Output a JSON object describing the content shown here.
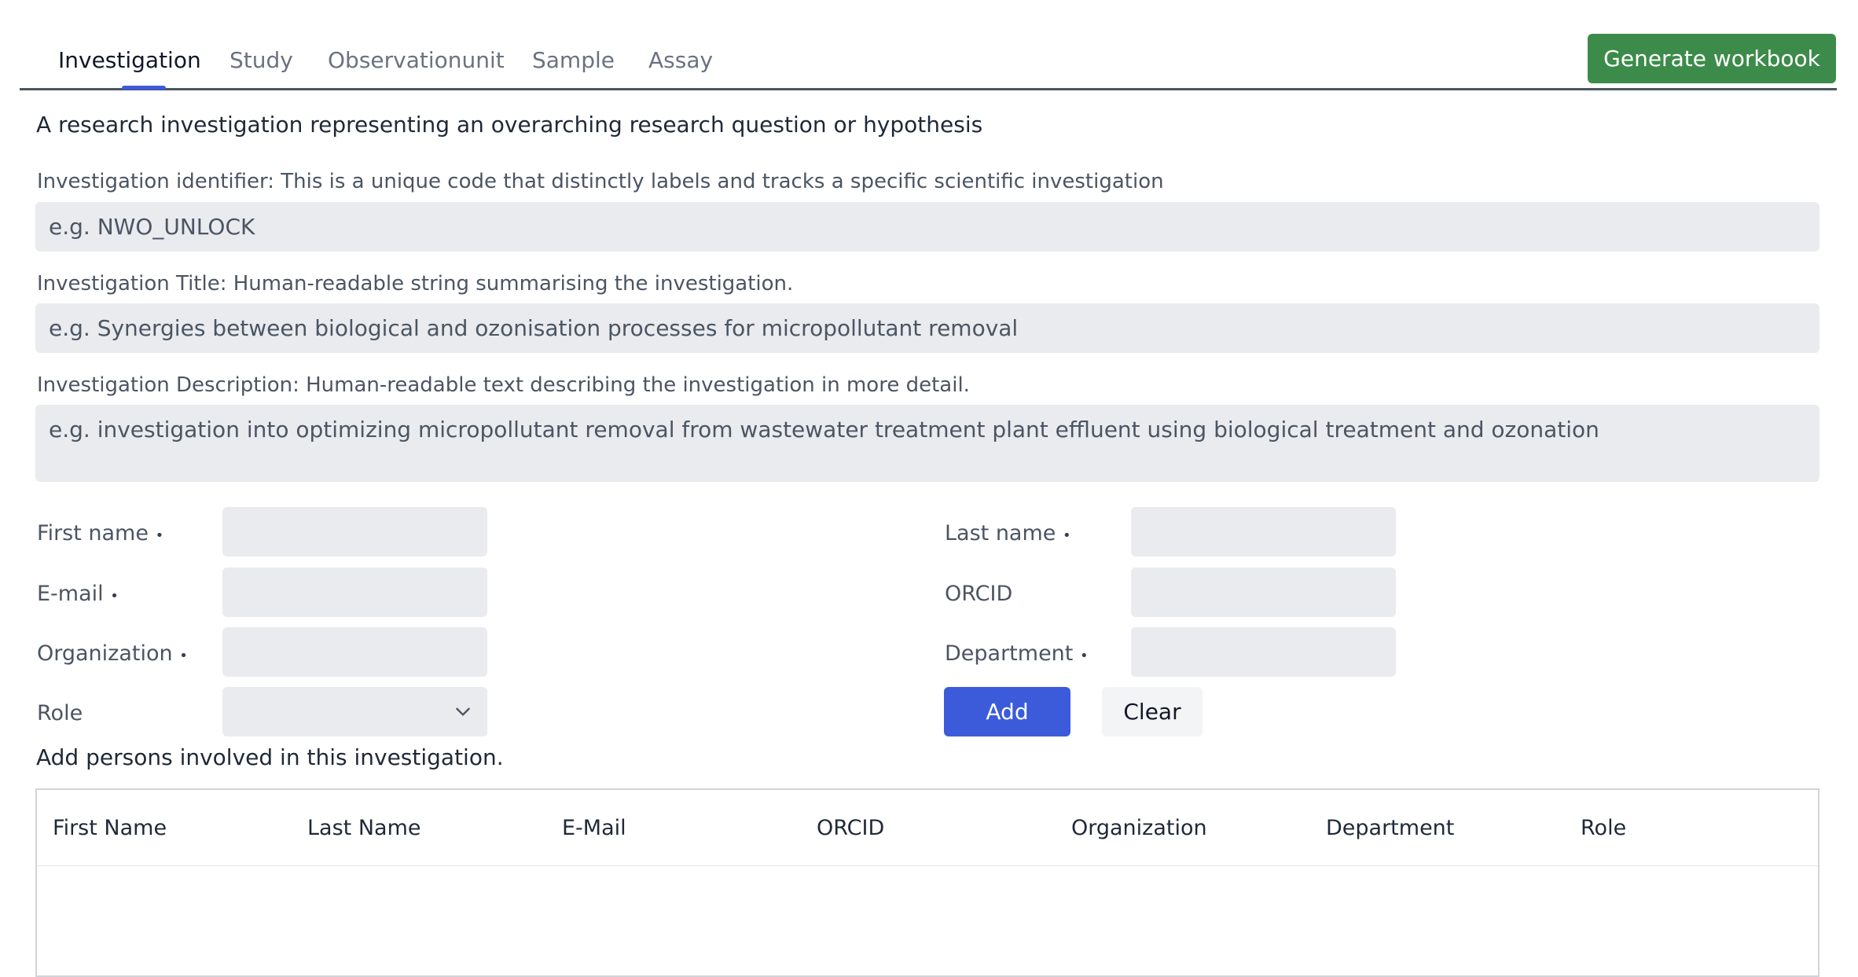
{
  "tabs": [
    {
      "label": "Investigation",
      "active": true
    },
    {
      "label": "Study"
    },
    {
      "label": "Observationunit"
    },
    {
      "label": "Sample"
    },
    {
      "label": "Assay"
    }
  ],
  "actions": {
    "generate_label": "Generate workbook"
  },
  "intro": "A research investigation representing an overarching research question or hypothesis",
  "fields": {
    "identifier": {
      "label": "Investigation identifier: This is a unique code that distinctly labels and tracks a specific scientific investigation",
      "placeholder": "e.g. NWO_UNLOCK",
      "value": ""
    },
    "title": {
      "label": "Investigation Title: Human-readable string summarising the investigation.",
      "placeholder": "e.g. Synergies between biological and ozonisation processes for micropollutant removal",
      "value": ""
    },
    "description": {
      "label": "Investigation Description: Human-readable text describing the investigation in more detail.",
      "placeholder": "e.g. investigation into optimizing micropollutant removal from wastewater treatment plant effluent using biological treatment and ozonation",
      "value": ""
    }
  },
  "person_form": {
    "required_marker": "•",
    "first_name": "First name",
    "last_name": "Last name",
    "email": "E-mail",
    "orcid": "ORCID",
    "organization": "Organization",
    "department": "Department",
    "role": "Role",
    "role_selected": "",
    "add_label": "Add",
    "clear_label": "Clear"
  },
  "persons_hint": "Add persons involved in this investigation.",
  "table": {
    "columns": [
      "First Name",
      "Last Name",
      "E-Mail",
      "ORCID",
      "Organization",
      "Department",
      "Role"
    ],
    "rows": []
  },
  "colors": {
    "primary": "#3b5bdb",
    "success": "#3d8b4a",
    "input_bg": "#e9ebef"
  }
}
